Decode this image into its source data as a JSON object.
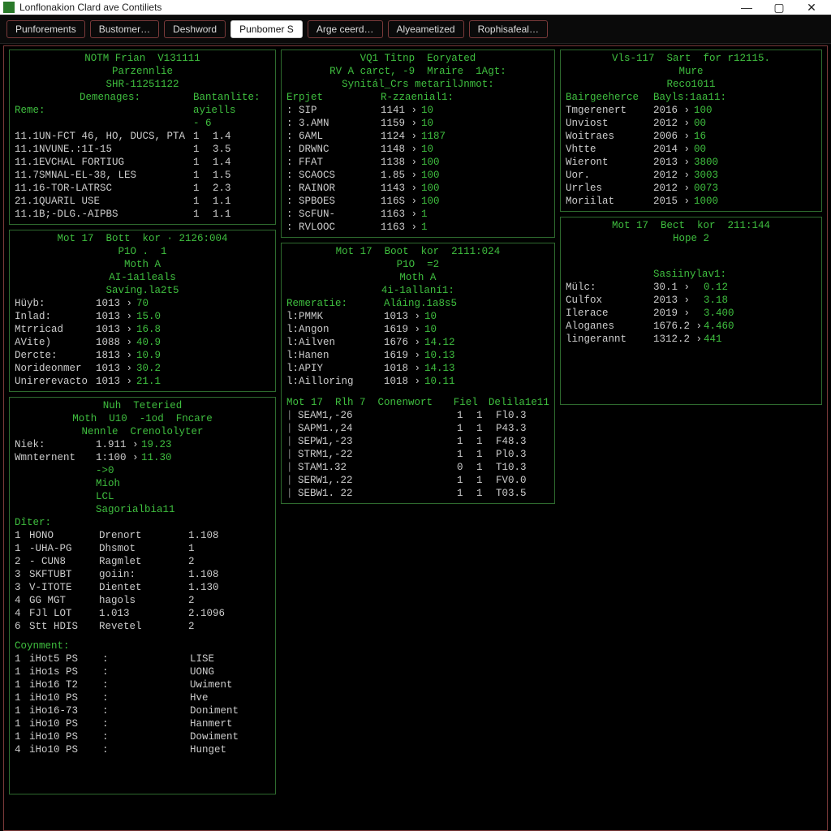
{
  "window": {
    "title": "Lonflonakion Clard ave Contiliets",
    "min": "—",
    "max": "▢",
    "close": "✕"
  },
  "tabs": [
    "Punforements",
    "Bustomer…",
    "Deshword",
    "Punbomer S",
    "Arge ceerd…",
    "Alyeametized",
    "Rophisafeal…"
  ],
  "active_tab": 3,
  "p1": {
    "headers": [
      "NOTM Frian  V131111",
      "Parzennlie",
      "SHR-11251122"
    ],
    "colhead_left": "Demenages:",
    "colhead_right": "Bantanlite:",
    "sub_left": "Reme:",
    "sub_right": "ayiells",
    "sub_right2": "- 6",
    "rows": [
      [
        "11.1UN-FCT 46, HO, DUCS, PTA",
        "1",
        "1.4"
      ],
      [
        "11.1NVUNE.:1I-15",
        "1",
        "3.5"
      ],
      [
        "11.1EVCHAL FORTIUG",
        "1",
        "1.4"
      ],
      [
        "11.7SMNAL-EL-38, LES",
        "1",
        "1.5"
      ],
      [
        "11.16-TOR-LATRSC",
        "1",
        "2.3"
      ],
      [
        "21.1QUARIL USE",
        "1",
        "1.1"
      ],
      [
        "11.1B;-DLG.-AIPBS",
        "1",
        "1.1"
      ]
    ]
  },
  "p2": {
    "headers": [
      "VQ1 Tîtnp  Eoryated",
      "RV A carct, -9  Mraire  1Agt:",
      "Synitál_Crs metarilJnmot:"
    ],
    "colhead_left": "Erpjet",
    "colhead_right": "R-zzaenial1:",
    "rows": [
      [
        "SIP",
        "1141",
        "10"
      ],
      [
        "3.AMN",
        "1159",
        "10"
      ],
      [
        "6AML",
        "1124",
        "1187"
      ],
      [
        "DRWNC",
        "1148",
        "10"
      ],
      [
        "FFAT",
        "1138",
        "100"
      ],
      [
        "SCAOCS",
        "1.85",
        "100"
      ],
      [
        "RAINOR",
        "1143",
        "100"
      ],
      [
        "SPBOES",
        "116S",
        "100"
      ],
      [
        "ScFUN-",
        "1163",
        "1"
      ],
      [
        "RVLOOC",
        "1163",
        "1"
      ]
    ]
  },
  "p3": {
    "headers": [
      "Vls-117  Sart  for r12115.",
      "Mure",
      "Reco1011"
    ],
    "colhead_left": "Bairgeeherce",
    "colhead_right": "Bayls:1aa11:",
    "rows": [
      [
        "Tmgerenert",
        "2016",
        "100"
      ],
      [
        "Unviost",
        "2012",
        "00"
      ],
      [
        "Woitraes",
        "2006",
        "16"
      ],
      [
        "Vhtte",
        "2014",
        "00"
      ],
      [
        "Wieront",
        "2013",
        "3800"
      ],
      [
        "Uor.",
        "2012",
        "3003"
      ],
      [
        "Urrles",
        "2012",
        "0073"
      ],
      [
        "Moriilat",
        "2015",
        "1000"
      ]
    ]
  },
  "p4": {
    "headers": [
      "Mot 17  Bott  kor · 2126:004",
      "P1O .  1",
      "Moth A",
      "AI-1a1leals",
      "Savíng.la2t5"
    ],
    "rows": [
      [
        "Hüyb:",
        "1013",
        "70"
      ],
      [
        "Inlad:",
        "1013",
        "15.0"
      ],
      [
        "Mtrricad",
        "1013",
        "16.8"
      ],
      [
        "AVite)",
        "1088",
        "40.9"
      ],
      [
        "Dercte:",
        "1813",
        "10.9"
      ],
      [
        "Norideonmer",
        "1013",
        "30.2"
      ],
      [
        "Unirerevacto",
        "1013",
        "21.1"
      ]
    ]
  },
  "p5": {
    "headers": [
      "Mot 17  Boot  kor  2111:024",
      "P1O  =2",
      "Moth A",
      "4i-1allaní1:"
    ],
    "colhead_left": "Remeratie:",
    "colhead_right": "Aláing.1a8s5",
    "rows": [
      [
        "l:PMMK",
        "1013",
        "10"
      ],
      [
        "l:Angon",
        "1619",
        "10"
      ],
      [
        "l:Ailven",
        "1676",
        "14.12"
      ],
      [
        "l:Hanen",
        "1619",
        "10.13"
      ],
      [
        "l:APIY",
        "1018",
        "14.13"
      ],
      [
        "l:Ailloring",
        "1018",
        "10.11"
      ]
    ],
    "cons_head": [
      "Mot 17  Rlh 7  Conenwort",
      "Fiel",
      "Delila1e11"
    ],
    "cons_rows": [
      [
        "|",
        "SEAM1,-26",
        "1",
        "1",
        "Fl0.3"
      ],
      [
        "|",
        "SAPM1.,24",
        "1",
        "1",
        "P43.3"
      ],
      [
        "|",
        "SEPW1,-23",
        "1",
        "1",
        "F48.3"
      ],
      [
        "|",
        "STRM1,-22",
        "1",
        "1",
        "Pl0.3"
      ],
      [
        "|",
        "STAM1.32",
        "0",
        "1",
        "T10.3"
      ],
      [
        "|",
        "SERW1,.22",
        "1",
        "1",
        "FV0.0"
      ],
      [
        "|",
        "SEBW1. 22",
        "1",
        "1",
        "T03.5"
      ]
    ]
  },
  "p6": {
    "headers": [
      "Mot 17  Bect  kor  211:144",
      "Hope 2"
    ],
    "colhead_right": "Sasiinylav1:",
    "rows": [
      [
        "Mülc:",
        "30.1",
        "0.12"
      ],
      [
        "Culfox",
        "2013",
        "3.18"
      ],
      [
        "Ilerace",
        "2019",
        "3.400"
      ],
      [
        "Aloganes",
        "1676.2",
        "4.460"
      ],
      [
        "lingerannt",
        "1312.2",
        "441"
      ]
    ]
  },
  "p7": {
    "headers": [
      "Nuh  Teteried",
      "Moth  U10  -1od  Fncare",
      "Nennle  Crenololyter"
    ],
    "top_rows": [
      [
        "Niek:",
        "1.911",
        "19.23"
      ],
      [
        "Wmnternent",
        "1:100",
        "11.30"
      ]
    ],
    "mid_lines": [
      "->0",
      "Mioh",
      "LCL",
      "Sagorialbia11"
    ],
    "diag_head": "Dîter:",
    "diag_rows": [
      [
        "1",
        "HONO",
        "Drenort",
        "1.108"
      ],
      [
        "1",
        "-UHA-PG",
        "Dhsmot",
        "1"
      ],
      [
        "2",
        "- CUN8",
        "Ragmlet",
        "2"
      ],
      [
        "3",
        "SKFTUBT",
        "goiin:",
        "1.108"
      ],
      [
        "3",
        "V-ITOTE",
        "Dientet",
        "1.130"
      ],
      [
        "4",
        "GG MGT",
        "hagols",
        "2"
      ],
      [
        "4",
        "FJl LOT",
        "1.013",
        "2.1096"
      ],
      [
        "6",
        "Stt HDIS",
        "Revetel",
        "2"
      ]
    ],
    "comment_head": "Coynment:",
    "comment_rows": [
      [
        "1",
        "iHot5 PS",
        ":",
        "LISE"
      ],
      [
        "1",
        "iHo1s PS",
        ":",
        "UONG"
      ],
      [
        "1",
        "iHo16 T2",
        ":",
        "Uwiment"
      ],
      [
        "1",
        "iHo10 PS",
        ":",
        "Hve"
      ],
      [
        "1",
        "iHo16-73",
        ":",
        "Doniment"
      ],
      [
        "1",
        "iHo10 PS",
        ":",
        "Hanmert"
      ],
      [
        "1",
        "iHo10 PS",
        ":",
        "Dowiment"
      ],
      [
        "4",
        "iHo10 PS",
        ":",
        "Hunget"
      ]
    ]
  }
}
